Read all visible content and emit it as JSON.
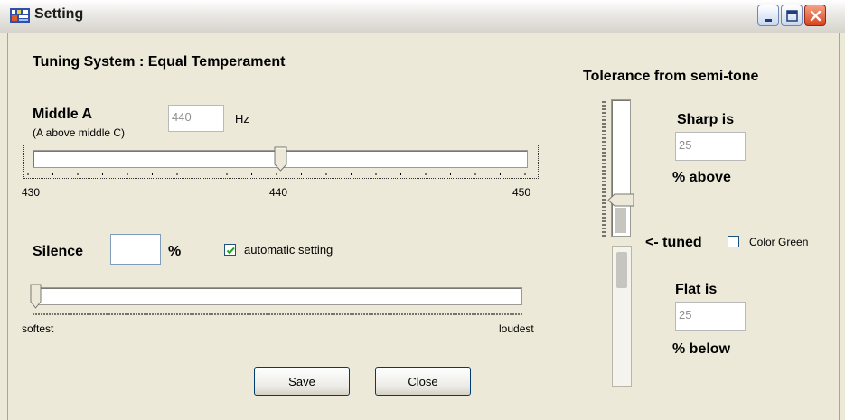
{
  "window": {
    "title": "Setting",
    "icon": "app-icon",
    "controls": [
      "minimize-icon",
      "maximize-icon",
      "close-icon"
    ]
  },
  "tuning": {
    "label": "Tuning System : Equal Temperament"
  },
  "middle_a": {
    "label": "Middle A",
    "sublabel": "(A above middle C)",
    "value": "440",
    "unit": "Hz",
    "slider": {
      "min_label": "430",
      "mid_label": "440",
      "max_label": "450",
      "min": 430,
      "max": 450,
      "value": 440
    }
  },
  "silence": {
    "label": "Silence",
    "value": "",
    "unit": "%",
    "auto_label": "automatic setting",
    "auto_checked": true,
    "slider": {
      "min_label": "softest",
      "max_label": "loudest",
      "value_fraction": 0.0
    }
  },
  "buttons": {
    "save": "Save",
    "close": "Close"
  },
  "tolerance": {
    "title": "Tolerance from semi-tone",
    "sharp_label": "Sharp is",
    "sharp_value": "25",
    "sharp_unit": "% above",
    "tuned_label": "<- tuned",
    "color_green_label": "Color Green",
    "color_green_checked": false,
    "flat_label": "Flat is",
    "flat_value": "25",
    "flat_unit": "% below"
  },
  "colors": {
    "titlebar": "#d6d4cc",
    "face": "#ece9d8",
    "close_button": "#d6441f",
    "disabled_text": "#8f8f8f"
  }
}
